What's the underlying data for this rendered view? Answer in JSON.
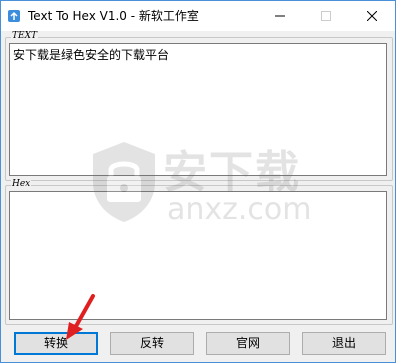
{
  "window": {
    "title": "Text To Hex V1.0 - 新软工作室",
    "controls": {
      "minimize_icon": "minimize-icon",
      "maximize_icon": "maximize-icon",
      "close_icon": "close-icon"
    }
  },
  "text_group": {
    "label": "TEXT",
    "value": "安下载是绿色安全的下载平台"
  },
  "hex_group": {
    "label": "Hex",
    "value": ""
  },
  "buttons": {
    "convert": "转换",
    "reverse": "反转",
    "official_site": "官网",
    "exit": "退出"
  },
  "watermark": {
    "cn": "安下载",
    "en": "anxz.com"
  },
  "colors": {
    "window_border": "#4a90d9",
    "background": "#f0f0f0",
    "focus_border": "#0078d7",
    "annotation_arrow": "#e02020"
  }
}
